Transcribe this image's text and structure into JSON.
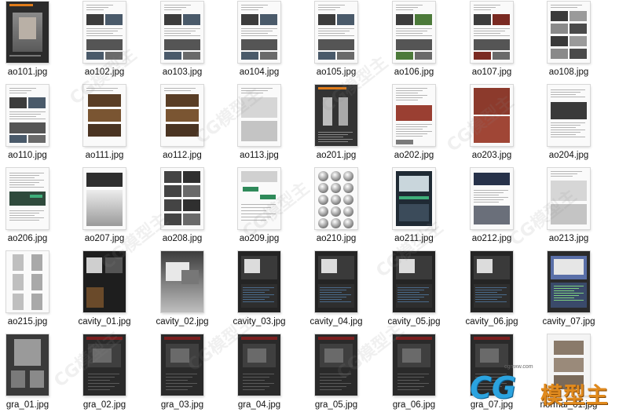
{
  "window": {
    "view": "large-icons"
  },
  "files": [
    {
      "name": "ao101.jpg",
      "style": "cover-dark"
    },
    {
      "name": "ao102.jpg",
      "style": "doc-photos"
    },
    {
      "name": "ao103.jpg",
      "style": "doc-photos"
    },
    {
      "name": "ao104.jpg",
      "style": "doc-photos"
    },
    {
      "name": "ao105.jpg",
      "style": "doc-photos"
    },
    {
      "name": "ao106.jpg",
      "style": "doc-photos-green"
    },
    {
      "name": "ao107.jpg",
      "style": "doc-photos-red"
    },
    {
      "name": "ao108.jpg",
      "style": "doc-grid"
    },
    {
      "name": "ao110.jpg",
      "style": "doc-photos"
    },
    {
      "name": "ao111.jpg",
      "style": "doc-warm"
    },
    {
      "name": "ao112.jpg",
      "style": "doc-warm"
    },
    {
      "name": "ao113.jpg",
      "style": "doc-light"
    },
    {
      "name": "ao201.jpg",
      "style": "cover-hydrant"
    },
    {
      "name": "ao202.jpg",
      "style": "doc-red"
    },
    {
      "name": "ao203.jpg",
      "style": "doc-hydrant-red"
    },
    {
      "name": "ao204.jpg",
      "style": "doc-text"
    },
    {
      "name": "ao206.jpg",
      "style": "doc-text-green"
    },
    {
      "name": "ao207.jpg",
      "style": "doc-gradient"
    },
    {
      "name": "ao208.jpg",
      "style": "doc-grid-dark"
    },
    {
      "name": "ao209.jpg",
      "style": "doc-ui-green"
    },
    {
      "name": "ao210.jpg",
      "style": "doc-spheres"
    },
    {
      "name": "ao211.jpg",
      "style": "doc-ui-dark"
    },
    {
      "name": "ao212.jpg",
      "style": "doc-ui-blue"
    },
    {
      "name": "ao213.jpg",
      "style": "doc-light"
    },
    {
      "name": "ao215.jpg",
      "style": "doc-hydrants"
    },
    {
      "name": "cavity_01.jpg",
      "style": "dark"
    },
    {
      "name": "cavity_02.jpg",
      "style": "gray"
    },
    {
      "name": "cavity_03.jpg",
      "style": "dark-ui"
    },
    {
      "name": "cavity_04.jpg",
      "style": "dark-ui"
    },
    {
      "name": "cavity_05.jpg",
      "style": "dark-ui"
    },
    {
      "name": "cavity_06.jpg",
      "style": "dark-ui"
    },
    {
      "name": "cavity_07.jpg",
      "style": "dark-ui-blue"
    },
    {
      "name": "gra_01.jpg",
      "style": "creature"
    },
    {
      "name": "gra_02.jpg",
      "style": "dark-red"
    },
    {
      "name": "gra_03.jpg",
      "style": "dark-red"
    },
    {
      "name": "gra_04.jpg",
      "style": "dark-red"
    },
    {
      "name": "gra_05.jpg",
      "style": "dark-red"
    },
    {
      "name": "gra_06.jpg",
      "style": "dark-red"
    },
    {
      "name": "gra_07.jpg",
      "style": "dark-red"
    },
    {
      "name": "normal_01.jpg",
      "style": "normal"
    }
  ],
  "watermark": {
    "diagonal_text": "CG模型主",
    "url": "cgmxw.com",
    "logo_mark": "CG",
    "logo_cn": "模型主"
  }
}
